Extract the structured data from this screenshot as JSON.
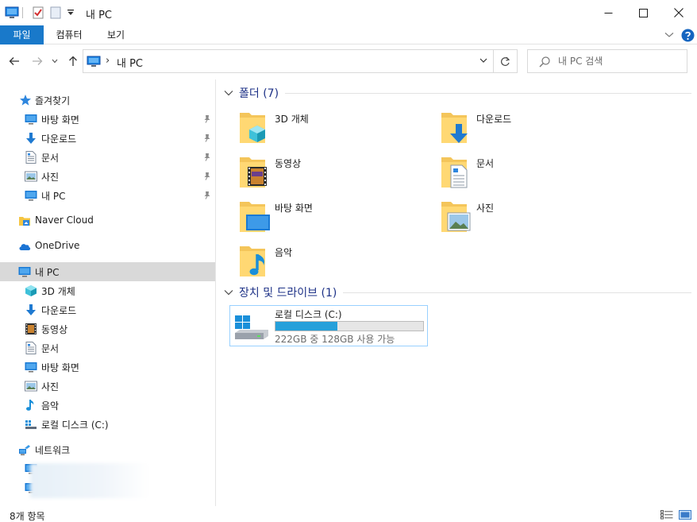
{
  "window": {
    "title": "내 PC",
    "icons": [
      "computer-icon",
      "properties-icon",
      "new-folder-icon",
      "customize-qa-icon"
    ],
    "controls": [
      "minimize",
      "maximize",
      "close"
    ]
  },
  "ribbon": {
    "tabs": [
      {
        "label": "파일",
        "active": true
      },
      {
        "label": "컴퓨터",
        "active": false
      },
      {
        "label": "보기",
        "active": false
      }
    ],
    "accent_color": "#1979ca"
  },
  "address": {
    "separator": "›",
    "crumb": "내 PC"
  },
  "search": {
    "placeholder": "내 PC 검색"
  },
  "nav": {
    "quick_access": {
      "label": "즐겨찾기",
      "items": [
        {
          "label": "바탕 화면",
          "icon": "desktop-icon",
          "pinned": true
        },
        {
          "label": "다운로드",
          "icon": "download-icon",
          "pinned": true
        },
        {
          "label": "문서",
          "icon": "document-icon",
          "pinned": true
        },
        {
          "label": "사진",
          "icon": "picture-icon",
          "pinned": true
        },
        {
          "label": "내 PC",
          "icon": "computer-icon",
          "pinned": true
        }
      ]
    },
    "naver_cloud": "Naver Cloud",
    "onedrive": "OneDrive",
    "this_pc": {
      "label": "내 PC",
      "selected": true,
      "items": [
        {
          "label": "3D 개체",
          "icon": "3d-objects-icon"
        },
        {
          "label": "다운로드",
          "icon": "download-icon"
        },
        {
          "label": "동영상",
          "icon": "video-icon"
        },
        {
          "label": "문서",
          "icon": "document-icon"
        },
        {
          "label": "바탕 화면",
          "icon": "desktop-icon"
        },
        {
          "label": "사진",
          "icon": "picture-icon"
        },
        {
          "label": "음악",
          "icon": "music-icon"
        },
        {
          "label": "로컬 디스크 (C:)",
          "icon": "drive-icon"
        }
      ]
    },
    "network": "네트워크"
  },
  "content": {
    "folders_header": "폴더 (7)",
    "folders": [
      {
        "name": "3D 개체",
        "overlay": "3d-objects-icon"
      },
      {
        "name": "다운로드",
        "overlay": "download-icon"
      },
      {
        "name": "동영상",
        "overlay": "video-icon"
      },
      {
        "name": "문서",
        "overlay": "document-icon"
      },
      {
        "name": "바탕 화면",
        "overlay": "desktop-icon"
      },
      {
        "name": "사진",
        "overlay": "picture-icon"
      },
      {
        "name": "음악",
        "overlay": "music-icon"
      }
    ],
    "drives_header": "장치 및 드라이브 (1)",
    "drive": {
      "name": "로컬 디스크 (C:)",
      "info": "222GB 중 128GB 사용 가능",
      "used_fraction": 0.42,
      "bar_color": "#26a0da"
    },
    "header_color": "#1e3287"
  },
  "status": {
    "item_count": "8개 항목"
  }
}
